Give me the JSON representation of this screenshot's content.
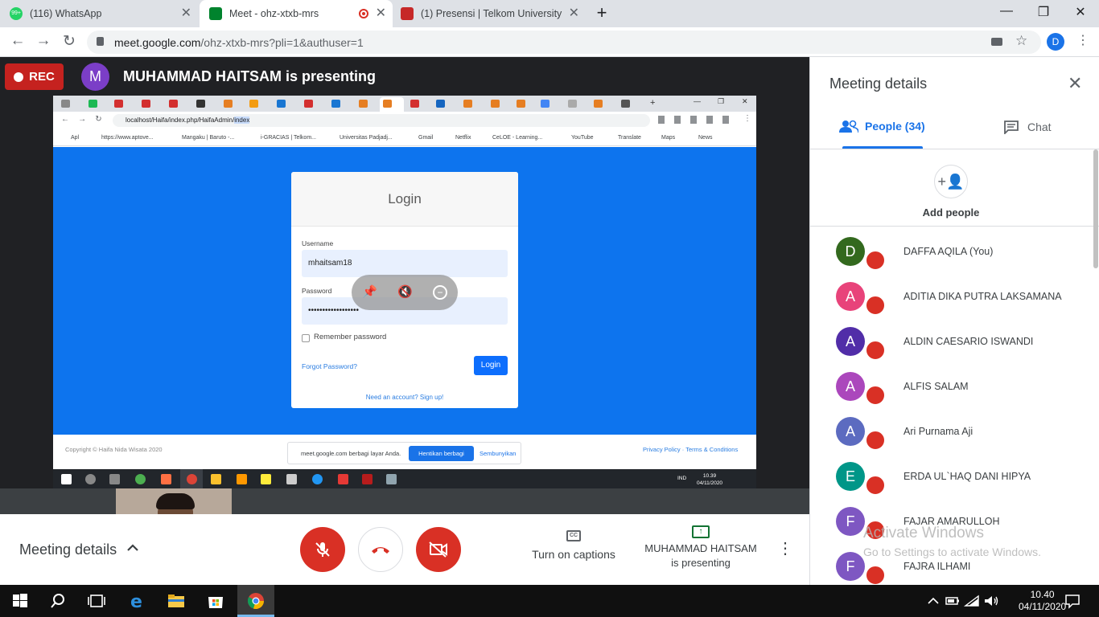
{
  "browser": {
    "tabs": [
      {
        "label": "(116) WhatsApp",
        "badge": "99+",
        "color": "#25d366"
      },
      {
        "label": "Meet - ohz-xtxb-mrs",
        "color": "#00832d"
      },
      {
        "label": "(1) Presensi | Telkom University",
        "color": "#c62828"
      }
    ],
    "url_host": "meet.google.com",
    "url_path": "/ohz-xtxb-mrs?pli=1&authuser=1",
    "profile_initial": "D"
  },
  "meet": {
    "rec_label": "REC",
    "presenter_initial": "M",
    "presenter_title": "MUHAMMAD HAITSAM is presenting"
  },
  "shared": {
    "url_prefix": "localhost/Haifa/index.php/HaifaAdmin/",
    "url_selected": "index",
    "bookmarks": [
      "Apl",
      "https://www.aptove...",
      "Mangaku | Baruto -...",
      "i-GRACIAS | Telkom...",
      "Universitas Padjadj...",
      "Gmail",
      "Netflix",
      "CeLOE - Learning...",
      "YouTube",
      "Translate",
      "Maps",
      "News"
    ],
    "login_title": "Login",
    "username_label": "Username",
    "username_value": "mhaitsam18",
    "password_label": "Password",
    "password_value": "••••••••••••••••••",
    "remember_label": "Remember password",
    "forgot_label": "Forgot Password?",
    "login_button": "Login",
    "signup_label": "Need an account? Sign up!",
    "footer_copyright": "Copyright © Haifa Nida Wisata 2020",
    "footer_links": "Privacy Policy · Terms & Conditions",
    "share_text": "meet.google.com berbagi layar Anda.",
    "share_stop": "Hentikan berbagi",
    "share_hide": "Sembunyikan",
    "lang": "IND",
    "time": "10.39",
    "date": "04/11/2020"
  },
  "bottom": {
    "meeting_details": "Meeting details",
    "captions": "Turn on captions",
    "presenting_line1": "MUHAMMAD HAITSAM",
    "presenting_line2": "is presenting"
  },
  "panel": {
    "title": "Meeting details",
    "people_tab": "People (34)",
    "chat_tab": "Chat",
    "add_people": "Add people",
    "participants": [
      {
        "initial": "D",
        "name": "DAFFA AQILA (You)",
        "color": "#33691e"
      },
      {
        "initial": "A",
        "name": "ADITIA DIKA PUTRA LAKSAMANA",
        "color": "#e8437a"
      },
      {
        "initial": "A",
        "name": "ALDIN CAESARIO ISWANDI",
        "color": "#512da8"
      },
      {
        "initial": "A",
        "name": "ALFIS SALAM",
        "color": "#ab47bc"
      },
      {
        "initial": "A",
        "name": "Ari Purnama Aji",
        "color": "#5c6bc0"
      },
      {
        "initial": "E",
        "name": "ERDA UL`HAQ DANI HIPYA",
        "color": "#009688"
      },
      {
        "initial": "F",
        "name": "FAJAR AMARULLOH",
        "color": "#7e57c2"
      },
      {
        "initial": "F",
        "name": "FAJRA ILHAMI",
        "color": "#7e57c2"
      }
    ]
  },
  "watermark": {
    "line1": "Activate Windows",
    "line2": "Go to Settings to activate Windows."
  },
  "taskbar": {
    "time": "10.40",
    "date": "04/11/2020"
  }
}
